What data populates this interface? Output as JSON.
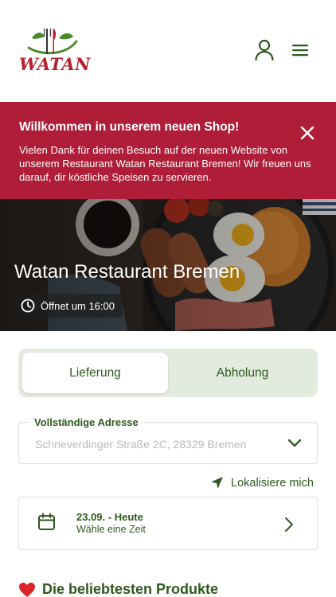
{
  "header": {
    "logo_text": "WATAN",
    "user_icon": "user-icon",
    "menu_icon": "hamburger-menu-icon"
  },
  "banner": {
    "title": "Willkommen in unserem neuen Shop!",
    "text": "Vielen Dank für deinen Besuch auf der neuen Website von unserem Restaurant Watan Restaurant Bremen! Wir freuen uns darauf, dir köstliche Speisen zu servieren.",
    "close_icon": "close-icon",
    "color": "#b01d38"
  },
  "hero": {
    "title": "Watan Restaurant Bremen",
    "hours": "Öffnet um 16:00",
    "clock_icon": "clock-icon"
  },
  "order_type": {
    "options": [
      "Lieferung",
      "Abholung"
    ],
    "selected": "Lieferung"
  },
  "address": {
    "label": "Vollständige Adresse",
    "value": "Schneverdinger Straße 2C, 28329 Bremen",
    "chevron_icon": "chevron-down-icon"
  },
  "locate": {
    "label": "Lokalisiere mich",
    "icon": "location-arrow-icon"
  },
  "date": {
    "main": "23.09. - Heute",
    "sub": "Wähle eine Zeit",
    "icon": "calendar-icon",
    "chevron_icon": "chevron-right-icon"
  },
  "section": {
    "title": "Die beliebtesten Produkte",
    "icon": "heart-icon"
  },
  "colors": {
    "brand_green": "#2e5a1f",
    "brand_red": "#b01d38",
    "toggle_bg": "#e3ebdf"
  }
}
